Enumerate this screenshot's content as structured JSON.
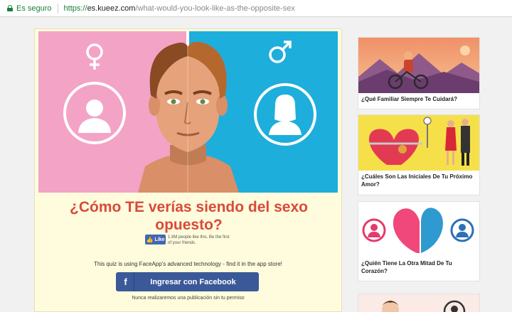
{
  "browser": {
    "secure_label": "Es seguro",
    "url_scheme": "https://",
    "url_host": "es.kueez.com",
    "url_path": "/what-would-you-look-like-as-the-opposite-sex"
  },
  "quiz": {
    "title": "¿Cómo TE verías siendo del sexo opuesto?",
    "like_label": "Like",
    "like_text": "1.9M people like this. Be the first of your friends.",
    "note": "This quiz is using FaceApp's advanced technology - find it in the app store!",
    "facebook_button": "Ingresar con Facebook",
    "facebook_icon": "f",
    "disclaimer": "Nunca realizaremos una publicación sin tu permiso"
  },
  "sidebar": [
    {
      "title": "¿Qué Familiar Siempre Te Cuidará?"
    },
    {
      "title": "¿Cuáles Son Las Iniciales De Tu Próximo Amor?"
    },
    {
      "title": "¿Quién Tiene La Otra Mitad De Tu Corazón?"
    },
    {
      "title": ""
    }
  ],
  "colors": {
    "title_red": "#d94a3c",
    "facebook_blue": "#3b5998",
    "hero_pink": "#f3a3c6",
    "hero_blue": "#1eaedc"
  }
}
